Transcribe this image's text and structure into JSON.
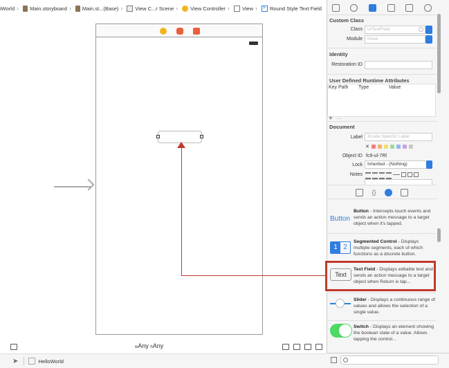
{
  "breadcrumb": [
    {
      "label": "iWorld",
      "icon": "folder-icon"
    },
    {
      "label": "Main.storyboard",
      "icon": "folder-icon"
    },
    {
      "label": "Main.st...(Base)",
      "icon": "storyboard-file-icon"
    },
    {
      "label": "View C...r Scene",
      "icon": "scene-icon"
    },
    {
      "label": "View Controller",
      "icon": "view-controller-icon"
    },
    {
      "label": "View",
      "icon": "view-icon"
    },
    {
      "label": "Round Style Text Field",
      "icon": "text-field-icon"
    }
  ],
  "canvas": {
    "size_class": "wAny hAny",
    "size_class_w": "w",
    "size_class_any1": "Any",
    "size_class_h": "h",
    "size_class_any2": "Any"
  },
  "debug_bar": {
    "target": "HelloWorld"
  },
  "inspector": {
    "custom_class": {
      "title": "Custom Class",
      "class_label": "Class",
      "class_placeholder": "UITextField",
      "module_label": "Module",
      "module_placeholder": "None"
    },
    "identity": {
      "title": "Identity",
      "restoration_label": "Restoration ID",
      "restoration_value": ""
    },
    "runtime": {
      "title": "User Defined Runtime Attributes",
      "col_key": "Key Path",
      "col_type": "Type",
      "col_value": "Value",
      "add": "+",
      "more": "···"
    },
    "document": {
      "title": "Document",
      "label_label": "Label",
      "label_placeholder": "Xcode Specific Label",
      "x_mark": "✕",
      "object_id_label": "Object ID",
      "object_id_value": "fc9-ul-7Rl",
      "lock_label": "Lock",
      "lock_value": "Inherited - (Nothing)",
      "notes_label": "Notes",
      "label_colors": [
        "#f08080",
        "#f4b46c",
        "#f2df6b",
        "#9fd89f",
        "#8fb9ec",
        "#c7a3e0",
        "#c8c8c8"
      ]
    }
  },
  "library": [
    {
      "name": "Button",
      "desc": " - Intercepts touch events and sends an action message to a target object when it's tapped.",
      "icon_text": "Button"
    },
    {
      "name": "Segmented Control",
      "desc": " - Displays multiple segments, each of which functions as a discrete button.",
      "icon_text1": "1",
      "icon_text2": "2"
    },
    {
      "name": "Text Field",
      "desc": " - Displays editable text and sends an action message to a target object when Return is tap...",
      "icon_text": "Text"
    },
    {
      "name": "Slider",
      "desc": " - Displays a continuous range of values and allows the selection of a single value."
    },
    {
      "name": "Switch",
      "desc": " - Displays an element showing the boolean state of a value. Allows tapping the control..."
    }
  ],
  "colors": {
    "accent": "#2f7de1",
    "connection": "#c0392b",
    "dock_yellow": "#f2b41c",
    "dock_orange": "#e8603c",
    "switch_green": "#4cd964"
  }
}
